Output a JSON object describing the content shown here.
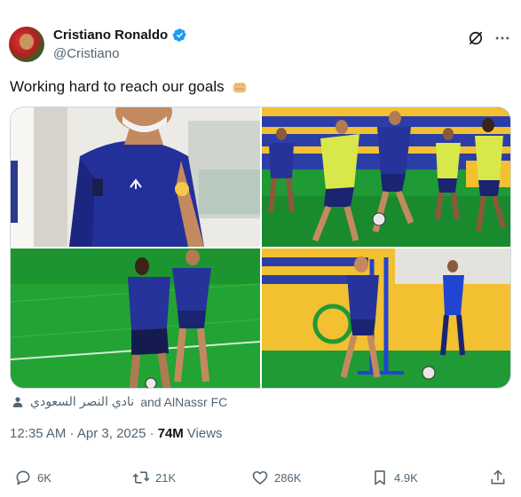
{
  "author": {
    "display_name": "Cristiano Ronaldo",
    "handle": "@Cristiano",
    "verified": true
  },
  "tweet": {
    "text": "Working hard to reach our goals"
  },
  "tagged": {
    "arabic_name": "نادي النصر السعودي",
    "suffix": "and AlNassr FC"
  },
  "meta": {
    "timestamp": "12:35 AM · Apr 3, 2025 ·",
    "views_count": "74M",
    "views_label": "Views"
  },
  "actions": {
    "replies": "6K",
    "reposts": "21K",
    "likes": "286K",
    "bookmarks": "4.9K"
  },
  "colors": {
    "verified_blue": "#1d9bf0",
    "text_primary": "#0f1419",
    "text_secondary": "#536471"
  }
}
